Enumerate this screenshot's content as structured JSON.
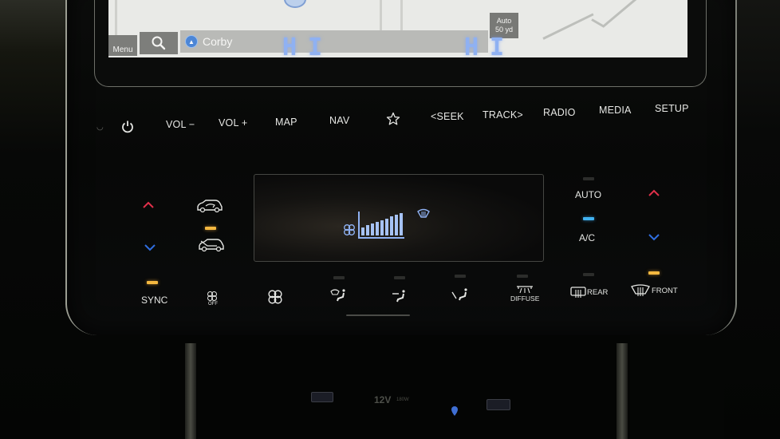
{
  "screen": {
    "menu_label": "Menu",
    "search_icon": "search-icon",
    "destination": "Corby",
    "destination_icon": "navigation-arrow-icon",
    "scale_mode": "Auto",
    "scale_value": "50 yd"
  },
  "hard_keys": {
    "power_icon": "power-icon",
    "vol_down": "VOL −",
    "vol_up": "VOL +",
    "map": "MAP",
    "nav": "NAV",
    "favorite_icon": "star-icon",
    "seek": "<SEEK",
    "track": "TRACK>",
    "radio": "RADIO",
    "media": "MEDIA",
    "setup": "SETUP"
  },
  "climate": {
    "driver_temp": "HI",
    "passenger_temp": "HI",
    "fan_level": 9,
    "fan_max": 9,
    "defrost_indicator_on": true,
    "left": {
      "temp_up_icon": "chevron-up-icon",
      "temp_down_icon": "chevron-down-icon",
      "recirculation_icon": "recirculation-icon",
      "fresh_air_icon": "fresh-air-icon",
      "sync_label": "SYNC"
    },
    "right": {
      "auto_label": "AUTO",
      "ac_label": "A/C",
      "temp_up_icon": "chevron-up-icon",
      "temp_down_icon": "chevron-down-icon"
    },
    "bottom_buttons": {
      "fan_off_label": "OFF",
      "diffuse_label": "DIFFUSE",
      "rear_label": "REAR",
      "front_label": "FRONT"
    },
    "colors": {
      "lcd_text": "#8fb1f2",
      "indicator_orange": "#f4b840",
      "indicator_blue": "#41b2f1",
      "arrow_up": "#e0304a",
      "arrow_down": "#2f6ee0"
    }
  },
  "lower_console": {
    "power_outlet": "12V",
    "power_rating": "180W"
  }
}
